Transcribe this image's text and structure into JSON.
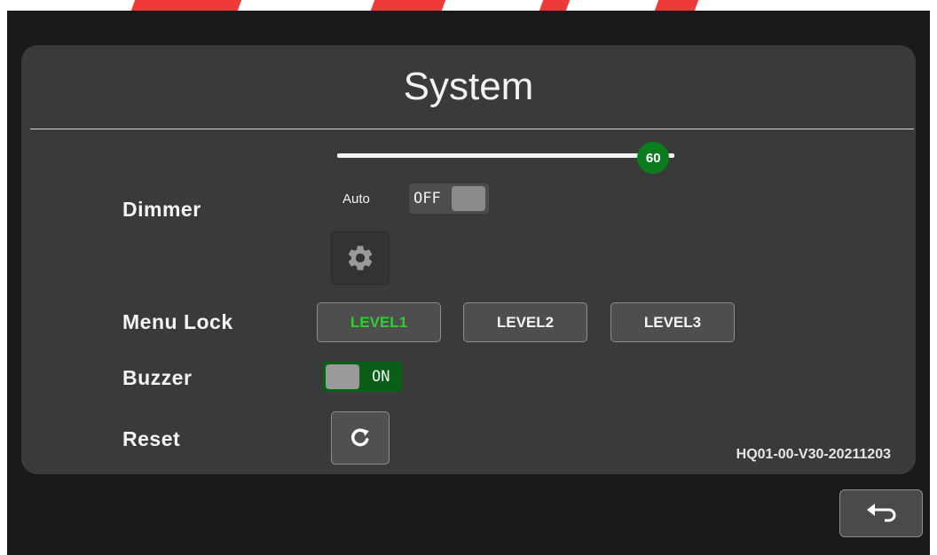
{
  "page": {
    "title": "System"
  },
  "dimmer": {
    "label": "Dimmer",
    "level": 60,
    "level_max": 64,
    "auto_label": "Auto",
    "auto_state": "OFF",
    "settings_icon": "gear-icon"
  },
  "menu_lock": {
    "label": "Menu Lock",
    "levels": [
      "LEVEL1",
      "LEVEL2",
      "LEVEL3"
    ],
    "selected": "LEVEL1"
  },
  "buzzer": {
    "label": "Buzzer",
    "state": "ON"
  },
  "reset": {
    "label": "Reset",
    "icon": "refresh-icon"
  },
  "version": "HQ01-00-V30-20211203",
  "back": {
    "icon": "back-arrow-icon"
  },
  "colors": {
    "accent_green": "#0b7d1f",
    "selected_text": "#2ecf2e",
    "panel": "#3a3a3a",
    "background": "#191919"
  }
}
